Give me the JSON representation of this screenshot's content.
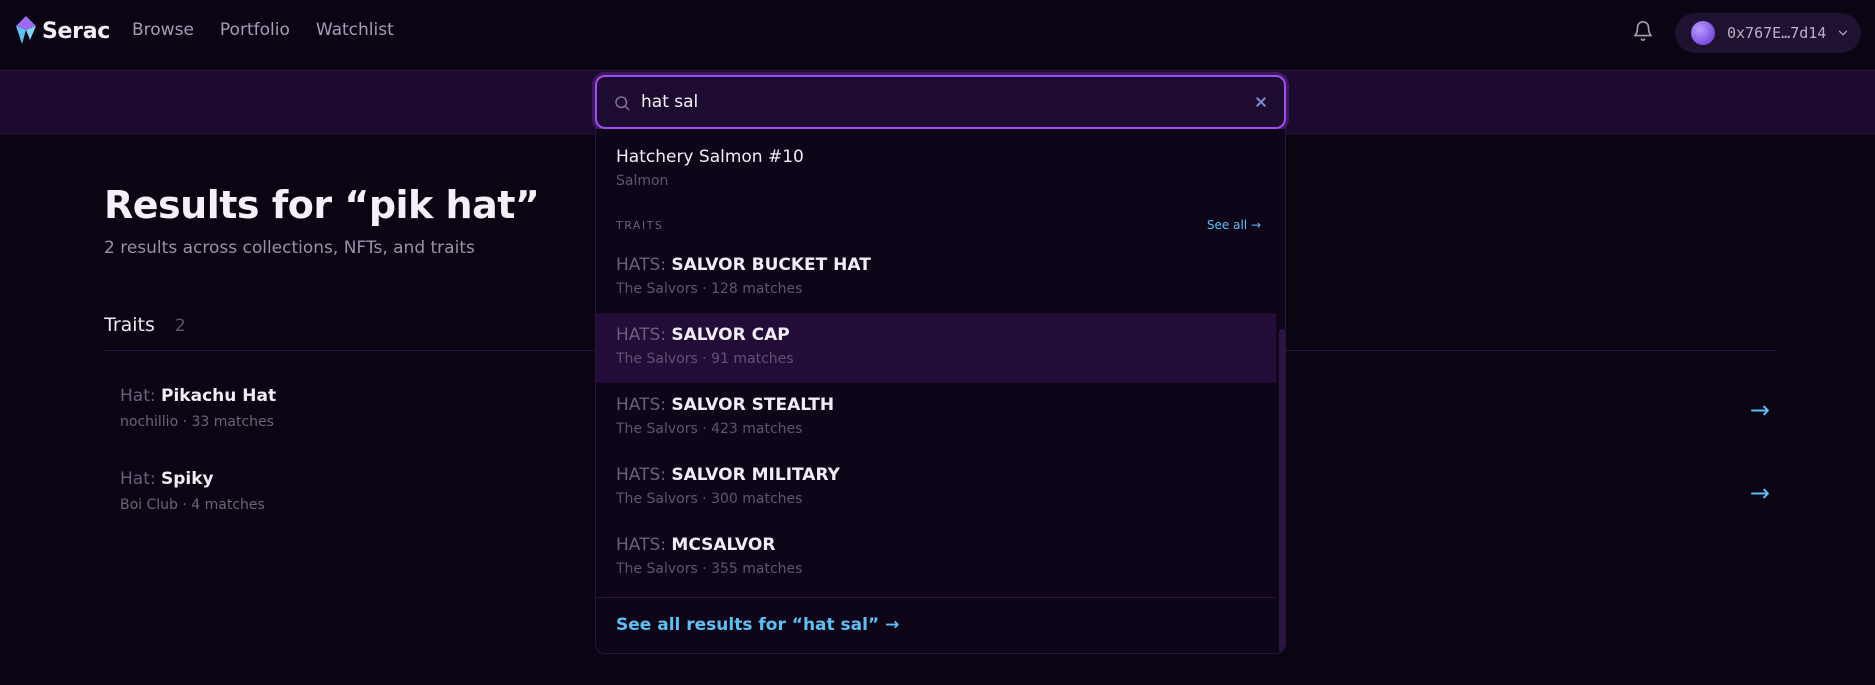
{
  "header": {
    "brand": "Serac",
    "nav": [
      "Browse",
      "Portfolio",
      "Watchlist"
    ],
    "wallet_address": "0x767E…7d14"
  },
  "search": {
    "query": "hat sal",
    "dropdown": {
      "nft_results": [
        {
          "title": "Hatchery Salmon #10",
          "subtitle": "Salmon"
        }
      ],
      "traits_label": "TRAITS",
      "see_all_label": "See all →",
      "traits": [
        {
          "prefix": "HATS:",
          "value": "SALVOR BUCKET HAT",
          "meta": "The Salvors · 128 matches"
        },
        {
          "prefix": "HATS:",
          "value": "SALVOR CAP",
          "meta": "The Salvors · 91 matches"
        },
        {
          "prefix": "HATS:",
          "value": "SALVOR STEALTH",
          "meta": "The Salvors · 423 matches"
        },
        {
          "prefix": "HATS:",
          "value": "SALVOR MILITARY",
          "meta": "The Salvors · 300 matches"
        },
        {
          "prefix": "HATS:",
          "value": "MCSALVOR",
          "meta": "The Salvors · 355 matches"
        }
      ],
      "footer_link": "See all results for “hat sal” →"
    }
  },
  "results": {
    "title": "Results for “pik hat”",
    "subtitle": "2 results across collections, NFTs, and traits",
    "section_title": "Traits",
    "section_count": "2",
    "traits": [
      {
        "prefix": "Hat:",
        "value": "Pikachu Hat",
        "meta": "nochillio · 33 matches",
        "arrow": "→"
      },
      {
        "prefix": "Hat:",
        "value": "Spiky",
        "meta": "Boi Club · 4 matches",
        "arrow": "→"
      }
    ]
  },
  "theme": {
    "background": "#0b0413",
    "accent_purple": "#a14df2",
    "link_blue": "#5cc1f2"
  },
  "icons": [
    "serac-logo-icon",
    "bell-icon",
    "chevron-down-icon",
    "search-icon",
    "close-icon",
    "arrow-right-icon"
  ]
}
